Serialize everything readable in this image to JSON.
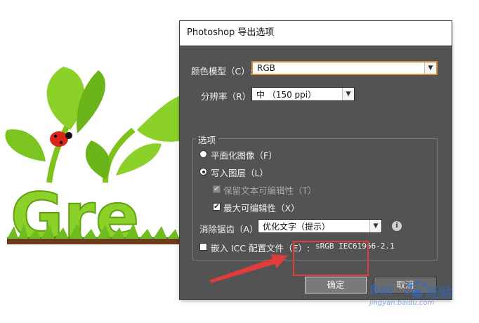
{
  "dialog": {
    "title": "Photoshop 导出选项",
    "color_model_label": "颜色模型（C）:",
    "color_model_value": "RGB",
    "resolution_label": "分辨率（R）:",
    "resolution_value": "中 （150 ppi）",
    "options_title": "选项",
    "flat_image_label": "平面化图像（F）",
    "write_layers_label": "写入图层（L）",
    "keep_text_label": "保留文本可编辑性（T）",
    "max_edit_label": "最大可编辑性（X）",
    "antialias_label": "消除锯齿（A）:",
    "antialias_value": "优化文字（提示）",
    "embed_icc_label": "嵌入 ICC 配置文件（E）:",
    "icc_value": "sRGB IEC61966-2.1",
    "ok_label": "确定",
    "cancel_label": "取消"
  },
  "state": {
    "flat_image_selected": false,
    "write_layers_selected": true,
    "keep_text_checked": true,
    "keep_text_disabled": true,
    "max_edit_checked": true,
    "embed_icc_checked": false
  },
  "colors": {
    "dialog_bg": "#535353",
    "focus_border": "#d98c3d",
    "annotation_red": "#e03c3c"
  },
  "icons": {
    "info": "i",
    "dropdown": "▼",
    "check": "✔"
  },
  "watermark": {
    "brand": "Bai",
    "brand_cn": "经验",
    "url": "jingyan.baidu.com"
  }
}
